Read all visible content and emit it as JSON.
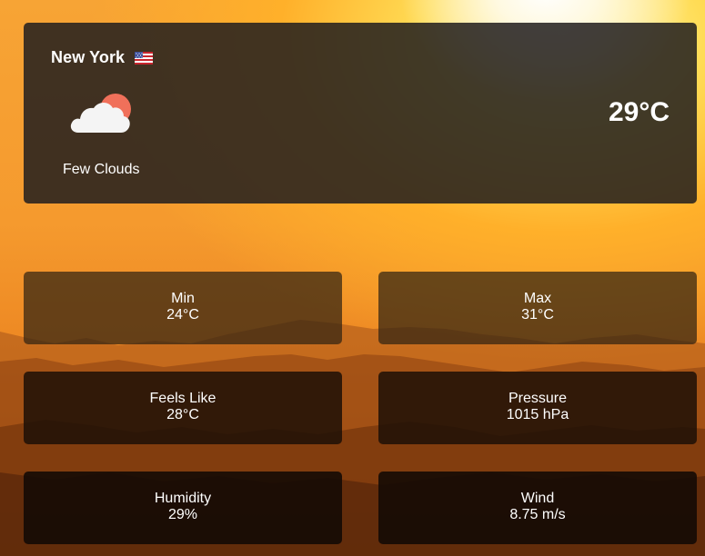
{
  "location": {
    "city": "New York",
    "flag_icon": "us-flag-icon"
  },
  "current": {
    "temperature": "29°C",
    "description": "Few Clouds",
    "icon": "partly-cloudy-icon"
  },
  "stats": {
    "min": {
      "label": "Min",
      "value": "24°C"
    },
    "max": {
      "label": "Max",
      "value": "31°C"
    },
    "feels_like": {
      "label": "Feels Like",
      "value": "28°C"
    },
    "pressure": {
      "label": "Pressure",
      "value": "1015 hPa"
    },
    "humidity": {
      "label": "Humidity",
      "value": "29%"
    },
    "wind": {
      "label": "Wind",
      "value": "8.75 m/s"
    }
  },
  "colors": {
    "sun_disc": "#f0705a",
    "cloud": "#f4f4f4",
    "sky_glow": "#ffdc55",
    "sky_orange": "#f59a2e"
  }
}
